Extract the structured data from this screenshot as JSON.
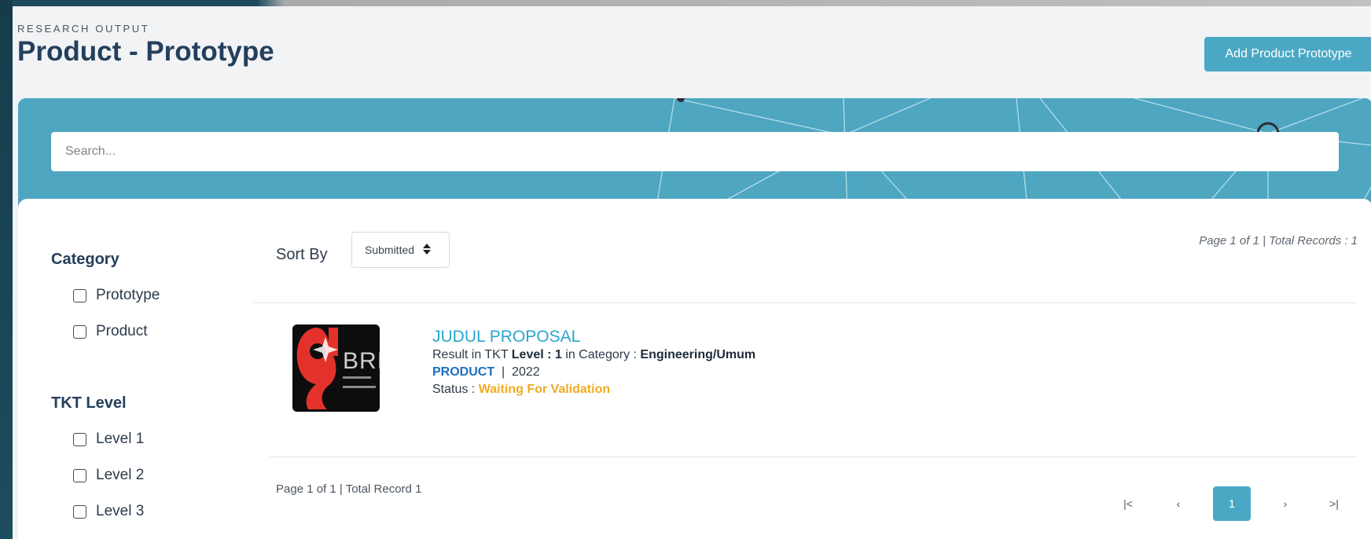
{
  "header": {
    "eyebrow": "RESEARCH OUTPUT",
    "title": "Product - Prototype",
    "add_button": "Add Product Prototype"
  },
  "search": {
    "placeholder": "Search..."
  },
  "filters": {
    "category": {
      "heading": "Category",
      "options": [
        "Prototype",
        "Product"
      ]
    },
    "tkt_level": {
      "heading": "TKT Level",
      "options": [
        "Level 1",
        "Level 2",
        "Level 3"
      ]
    }
  },
  "sort": {
    "label": "Sort By",
    "value": "Submitted"
  },
  "page_info_top": "Page 1 of 1 | Total Records : 1",
  "results": [
    {
      "logo_text": "BRIN",
      "title": "JUDUL PROPOSAL",
      "line1_prefix": "Result in TKT ",
      "level_label": "Level : 1",
      "line1_mid": " in Category : ",
      "category": "Engineering/Umum",
      "type": "PRODUCT",
      "separator": "|",
      "year": "2022",
      "status_label": "Status : ",
      "status": "Waiting For Validation"
    }
  ],
  "page_info_bottom": "Page 1 of 1 | Total Record 1",
  "pagination": {
    "first": "|<",
    "prev": "‹",
    "current": "1",
    "next": "›",
    "last": ">|"
  },
  "colors": {
    "accent": "#4ba8c5",
    "title": "#243f5c",
    "link": "#2aa6cf",
    "status": "#f0ab23",
    "product": "#1f6fc0"
  }
}
